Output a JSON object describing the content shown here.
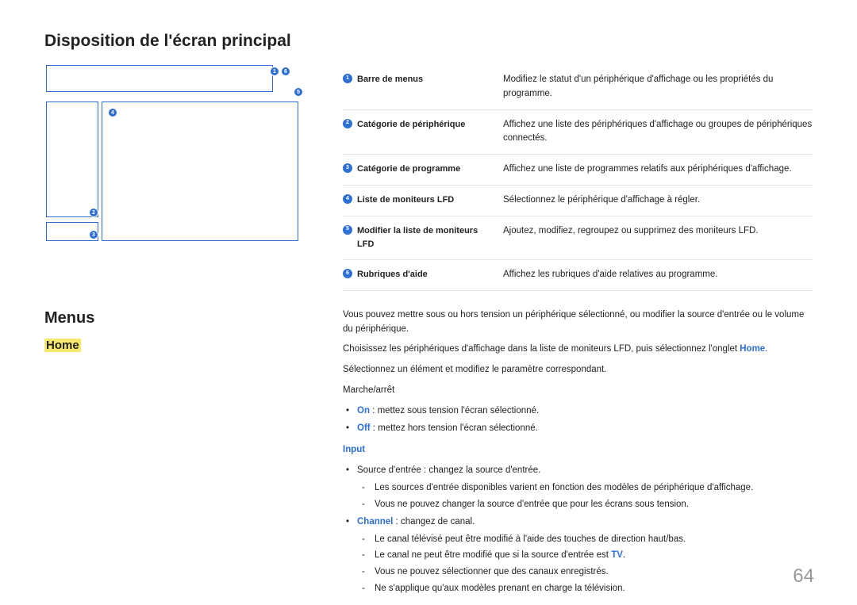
{
  "title": "Disposition de l'écran principal",
  "wireframe_callouts": [
    "1",
    "2",
    "3",
    "4",
    "5",
    "6"
  ],
  "table": [
    {
      "num": "1",
      "label": "Barre de menus",
      "desc": "Modifiez le statut d'un périphérique d'affichage ou les propriétés du programme."
    },
    {
      "num": "2",
      "label": "Catégorie de périphérique",
      "desc": "Affichez une liste des périphériques d'affichage ou groupes de périphériques connectés."
    },
    {
      "num": "3",
      "label": "Catégorie de programme",
      "desc": "Affichez une liste de programmes relatifs aux périphériques d'affichage."
    },
    {
      "num": "4",
      "label": "Liste de moniteurs LFD",
      "desc": "Sélectionnez le périphérique d'affichage à régler."
    },
    {
      "num": "5",
      "label": "Modifier la liste de moniteurs LFD",
      "desc": "Ajoutez, modifiez, regroupez ou supprimez des moniteurs LFD."
    },
    {
      "num": "6",
      "label": "Rubriques d'aide",
      "desc": "Affichez les rubriques d'aide relatives au programme."
    }
  ],
  "menus_heading": "Menus",
  "home_heading": "Home",
  "para_intro": "Vous pouvez mettre sous ou hors tension un périphérique sélectionné, ou modifier la source d'entrée ou le volume du périphérique.",
  "para_choose_pre": "Choisissez les périphériques d'affichage dans la liste de moniteurs LFD, puis sélectionnez l'onglet ",
  "para_choose_kw": "Home",
  "para_choose_post": ".",
  "para_select": "Sélectionnez un élément et modifiez le paramètre correspondant.",
  "marche": "Marche/arrêt",
  "on_kw": "On",
  "on_text": " : mettez sous tension l'écran sélectionné.",
  "off_kw": "Off",
  "off_text": " : mettez hors tension l'écran sélectionné.",
  "input_kw": "Input",
  "source_line": "Source d'entrée : changez la source d'entrée.",
  "source_sub1": "Les sources d'entrée disponibles varient en fonction des modèles de périphérique d'affichage.",
  "source_sub2": "Vous ne pouvez changer la source d'entrée que pour les écrans sous tension.",
  "channel_kw": "Channel",
  "channel_text": " : changez de canal.",
  "channel_sub1": "Le canal télévisé peut être modifié à l'aide des touches de direction haut/bas.",
  "channel_sub2_pre": "Le canal ne peut être modifié que si la source d'entrée est ",
  "channel_sub2_kw": "TV",
  "channel_sub2_post": ".",
  "channel_sub3": "Vous ne pouvez sélectionner que des canaux enregistrés.",
  "channel_sub4": "Ne s'applique qu'aux modèles prenant en charge la télévision.",
  "page_number": "64"
}
